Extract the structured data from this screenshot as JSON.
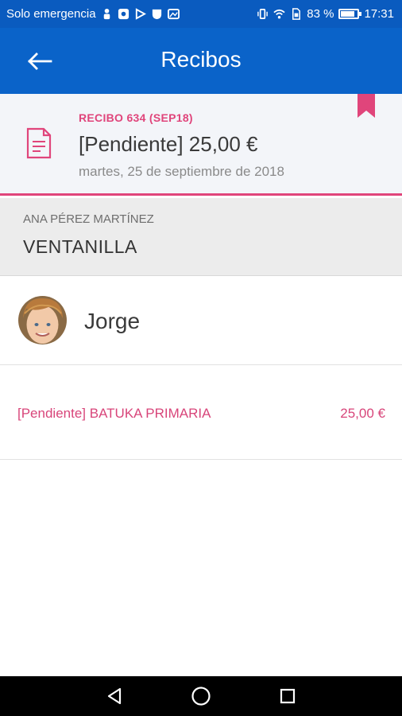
{
  "status_bar": {
    "carrier": "Solo emergencia",
    "battery_percent": "83 %",
    "battery_level": 0.83,
    "time": "17:31"
  },
  "app_bar": {
    "title": "Recibos",
    "back_icon": "arrow-left-icon",
    "background": "#0a63c9"
  },
  "receipt": {
    "code": "RECIBO 634 (SEP18)",
    "amount": "[Pendiente] 25,00 €",
    "date": "martes, 25 de septiembre de 2018",
    "icon": "document-icon",
    "bookmark_icon": "bookmark-icon",
    "accent": "#e0457b"
  },
  "payer": {
    "name": "ANA PÉREZ MARTÍNEZ",
    "payment_method": "VENTANILLA"
  },
  "child": {
    "name": "Jorge",
    "avatar_icon": "child-avatar"
  },
  "concepts": [
    {
      "label": "[Pendiente] BATUKA PRIMARIA",
      "amount": "25,00 €"
    }
  ],
  "nav_bar": {
    "back_icon": "triangle-back-icon",
    "home_icon": "circle-home-icon",
    "recents_icon": "square-recents-icon"
  }
}
